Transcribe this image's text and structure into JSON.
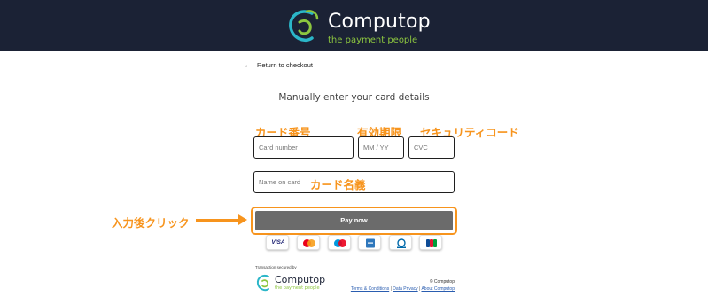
{
  "header": {
    "brand": "Computop",
    "tagline": "the payment people",
    "background": "#1b2235",
    "tagline_color": "#8cc63f"
  },
  "nav": {
    "back_label": "Return to checkout"
  },
  "form": {
    "heading": "Manually enter your card details",
    "card_number_placeholder": "Card number",
    "expiry_placeholder": "MM / YY",
    "cvc_placeholder": "CVC",
    "name_placeholder": "Name on card",
    "pay_label": "Pay now",
    "pay_color": "#6b6b6b"
  },
  "annotations": {
    "card_number": "カード番号",
    "expiry": "有効期限",
    "cvc": "セキュリティコード",
    "name": "カード名義",
    "pay_instruction": "入力後クリック",
    "color": "#f7941d"
  },
  "card_brands": [
    "visa",
    "mastercard",
    "maestro",
    "amex",
    "diners",
    "jcb"
  ],
  "card_brand_labels": {
    "visa": "VISA"
  },
  "footer": {
    "secured_label": "Transaction secured by",
    "brand": "Computop",
    "tagline": "the payment people",
    "copyright": "© Computop",
    "links": [
      "Terms & Conditions",
      "Data Privacy",
      "About Computop"
    ],
    "separator": "|"
  }
}
